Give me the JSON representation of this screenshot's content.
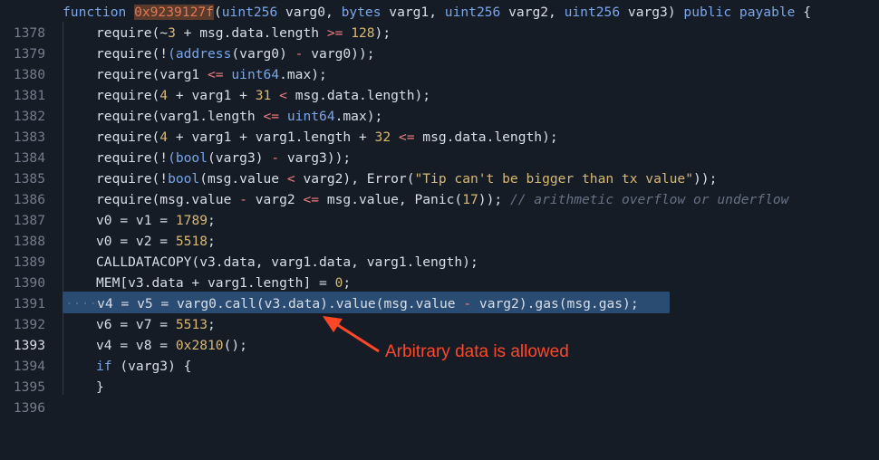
{
  "line_numbers": [
    "1378",
    "1379",
    "1380",
    "1381",
    "1382",
    "1383",
    "1384",
    "1385",
    "1386",
    "1387",
    "1388",
    "1389",
    "1390",
    "1391",
    "1392",
    "1393",
    "1394",
    "1395",
    "1396"
  ],
  "code": {
    "l1378": {
      "t0": "function ",
      "addr": "0x9239127f",
      "t1": "(",
      "ty0": "uint256",
      "t2": " varg0, ",
      "ty1": "bytes",
      "t3": " varg1, ",
      "ty2": "uint256",
      "t4": " varg2, ",
      "ty3": "uint256",
      "t5": " varg3) ",
      "k0": "public payable",
      "t6": " {"
    },
    "l1379": {
      "a": "require(~",
      "n0": "3",
      "b": " + msg.data.length ",
      "o0": ">=",
      "c": " ",
      "n1": "128",
      "d": ");"
    },
    "l1380": {
      "a": "require(!",
      "ty": "(address",
      "b": "(varg0) ",
      "o0": "-",
      "c": " varg0));"
    },
    "l1381": {
      "a": "require(varg1 ",
      "o0": "<=",
      "b": " ",
      "ty": "uint64",
      "c": ".max);"
    },
    "l1382": {
      "a": "require(",
      "n0": "4",
      "b": " + varg1 + ",
      "n1": "31",
      "c": " ",
      "o0": "<",
      "d": " msg.data.length);"
    },
    "l1383": {
      "a": "require(varg1.length ",
      "o0": "<=",
      "b": " ",
      "ty": "uint64",
      "c": ".max);"
    },
    "l1384": {
      "a": "require(",
      "n0": "4",
      "b": " + varg1 + varg1.length + ",
      "n1": "32",
      "c": " ",
      "o0": "<=",
      "d": " msg.data.length);"
    },
    "l1385": {
      "a": "require(!",
      "ty": "(bool",
      "b": "(varg3) ",
      "o0": "-",
      "c": " varg3));"
    },
    "l1386": {
      "a": "require(!",
      "ty": "bool",
      "b": "(msg.value ",
      "o0": "<",
      "c": " varg2), Error(",
      "s": "\"Tip can't be bigger than tx value\"",
      "d": "));"
    },
    "l1387": {
      "a": "require(msg.value ",
      "o0": "-",
      "b": " varg2 ",
      "o1": "<=",
      "c": " msg.value, Panic(",
      "n0": "17",
      "d": ")); ",
      "cm": "// arithmetic overflow or underflow"
    },
    "l1388": {
      "a": "v0 = v1 = ",
      "n0": "1789",
      "b": ";"
    },
    "l1389": {
      "a": "v0 = v2 = ",
      "n0": "5518",
      "b": ";"
    },
    "l1390": {
      "a": "CALLDATACOPY(v3.data, varg1.data, varg1.length);"
    },
    "l1391": {
      "a": "MEM[v3.data + varg1.length] = ",
      "n0": "0",
      "b": ";"
    },
    "l1392": {
      "ws": "····",
      "a": "v4 = v5 = varg0.call(v3.data).value(msg.value ",
      "o0": "-",
      "b": " varg2).gas(msg.gas);"
    },
    "l1393": {
      "a": "v6 = v7 = ",
      "n0": "5513",
      "b": ";"
    },
    "l1394": {
      "a": "v4 = v8 = ",
      "n0": "0x2810",
      "b": "();"
    },
    "l1395": {
      "k0": "if",
      "a": " (varg3) {"
    },
    "l1396": {
      "a": "}"
    }
  },
  "annotation": {
    "text": "Arbitrary data is allowed",
    "color": "#ff4726"
  },
  "colors": {
    "background": "#161c26",
    "keyword": "#79a6e8",
    "number": "#d8b872",
    "operator": "#f07d82",
    "highlight": "#2b4c72",
    "annotation": "#ff4726"
  }
}
